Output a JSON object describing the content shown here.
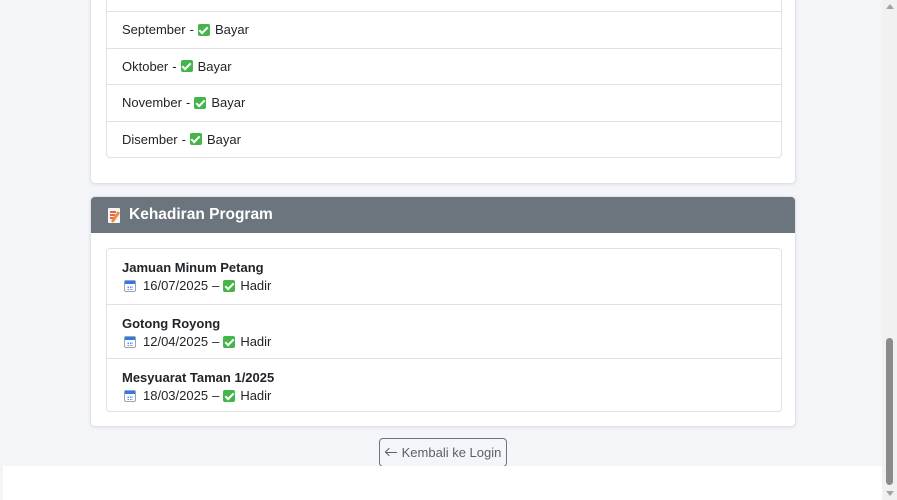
{
  "fees": {
    "items": [
      {
        "month": "September",
        "separator": "-",
        "status": "Bayar"
      },
      {
        "month": "Oktober",
        "separator": "-",
        "status": "Bayar"
      },
      {
        "month": "November",
        "separator": "-",
        "status": "Bayar"
      },
      {
        "month": "Disember",
        "separator": "-",
        "status": "Bayar"
      }
    ]
  },
  "programs": {
    "title": "Kehadiran Program",
    "header_icon": "memo-icon",
    "header_color": "#6c757d",
    "items": [
      {
        "name": "Jamuan Minum Petang",
        "date": "16/07/2025",
        "separator": "–",
        "status": "Hadir"
      },
      {
        "name": "Gotong Royong",
        "date": "12/04/2025",
        "separator": "–",
        "status": "Hadir"
      },
      {
        "name": "Mesyuarat Taman 1/2025",
        "date": "18/03/2025",
        "separator": "–",
        "status": "Hadir"
      }
    ]
  },
  "back_button": {
    "label": "Kembali ke Login",
    "icon": "arrow-left-icon"
  },
  "colors": {
    "check": "#43b549",
    "page_bg": "#f4f5f9"
  }
}
